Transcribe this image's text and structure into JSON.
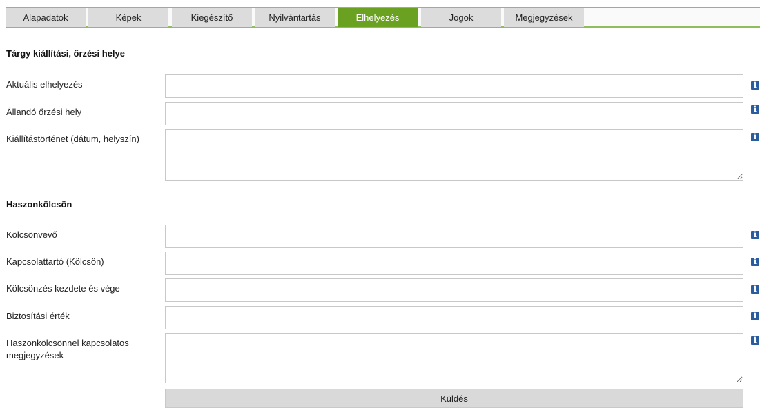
{
  "tabs": [
    {
      "label": "Alapadatok"
    },
    {
      "label": "Képek"
    },
    {
      "label": "Kiegészítő"
    },
    {
      "label": "Nyilvántartás"
    },
    {
      "label": "Elhelyezés"
    },
    {
      "label": "Jogok"
    },
    {
      "label": "Megjegyzések"
    }
  ],
  "active_tab": "Elhelyezés",
  "accent_color": "#6aa121",
  "section1": {
    "title": "Tárgy kiállítási, őrzési helye",
    "fields": [
      {
        "label": "Aktuális elhelyezés",
        "value": ""
      },
      {
        "label": "Állandó őrzési hely",
        "value": ""
      },
      {
        "label": "Kiállítástörténet (dátum, helyszín)",
        "value": ""
      }
    ]
  },
  "section2": {
    "title": "Haszonkölcsön",
    "fields": [
      {
        "label": "Kölcsönvevő",
        "value": ""
      },
      {
        "label": "Kapcsolattartó (Kölcsön)",
        "value": ""
      },
      {
        "label": "Kölcsönzés kezdete és vége",
        "value": ""
      },
      {
        "label": "Biztosítási érték",
        "value": ""
      },
      {
        "label": "Haszonkölcsönnel kapcsolatos megjegyzések",
        "value": ""
      }
    ]
  },
  "info_icon": {
    "name": "info-icon",
    "glyph": "i"
  },
  "submit_label": "Küldés"
}
